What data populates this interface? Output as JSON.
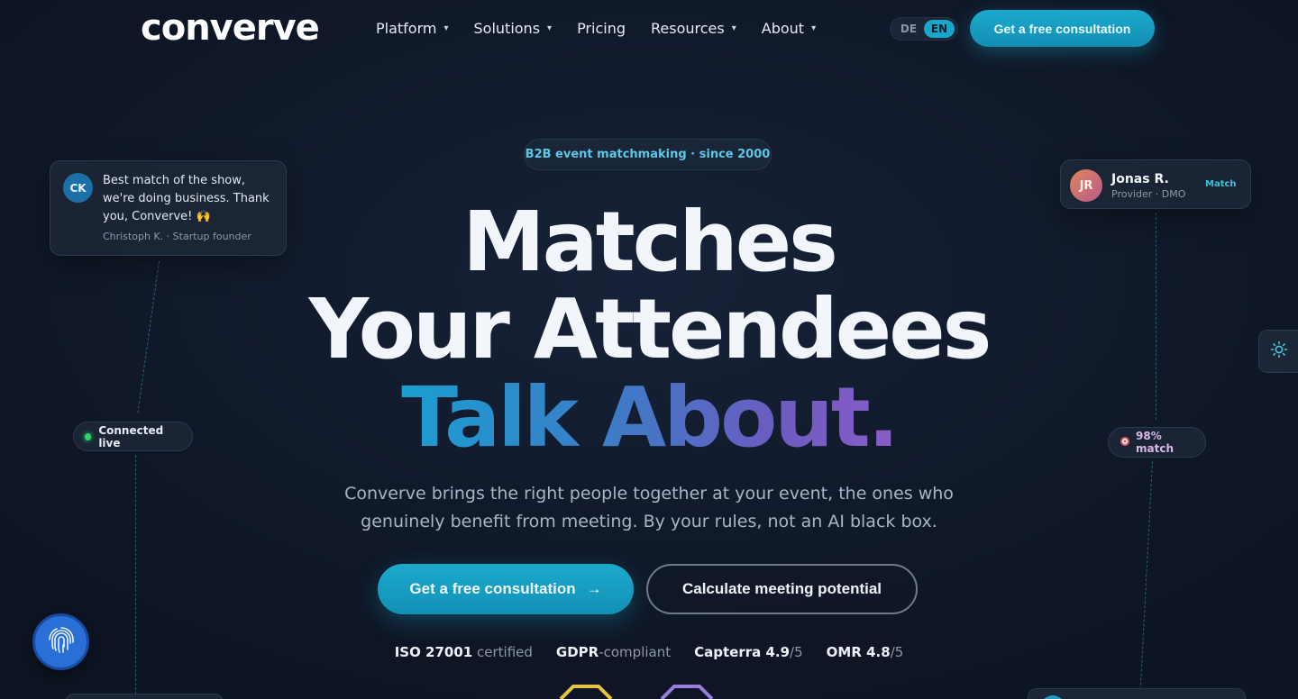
{
  "nav": {
    "logo": "converve",
    "menu": [
      {
        "label": "Platform",
        "dropdown": true
      },
      {
        "label": "Solutions",
        "dropdown": true
      },
      {
        "label": "Pricing",
        "dropdown": false
      },
      {
        "label": "Resources",
        "dropdown": true
      },
      {
        "label": "About",
        "dropdown": true
      }
    ],
    "lang_de": "DE",
    "lang_en": "EN",
    "cta": "Get a free consultation"
  },
  "hero": {
    "badge": "B2B event matchmaking · since 2000",
    "line1": "Matches",
    "line2": "Your Attendees",
    "line3": "Talk About.",
    "subtitle": "Converve brings the right people together at your event, the ones who genuinely benefit from meeting. By your rules, not an AI black box.",
    "cta_primary": "Get a free consultation",
    "cta_primary_arrow": "→",
    "cta_secondary": "Calculate meeting potential"
  },
  "trust": [
    {
      "strong": "ISO 27001",
      "rest": " certified"
    },
    {
      "strong": "GDPR",
      "rest": "-compliant"
    },
    {
      "strong": "Capterra 4.9",
      "rest": "/5"
    },
    {
      "strong": "OMR 4.8",
      "rest": "/5"
    }
  ],
  "testimonial": {
    "initials": "CK",
    "quote": "Best match of the show, we're doing business. Thank you, Converve! 🙌",
    "author": "Christoph K. · Startup founder"
  },
  "provider": {
    "initials": "JR",
    "name": "Jonas R.",
    "role": "Provider · DMO",
    "tag": "Match"
  },
  "pills": {
    "connected": "Connected live",
    "match": "98% match"
  },
  "colors": {
    "accent": "#18a6c9",
    "background": "#0f1726",
    "gradient_start": "#1a9ed0",
    "gradient_end": "#8b5cc8"
  }
}
